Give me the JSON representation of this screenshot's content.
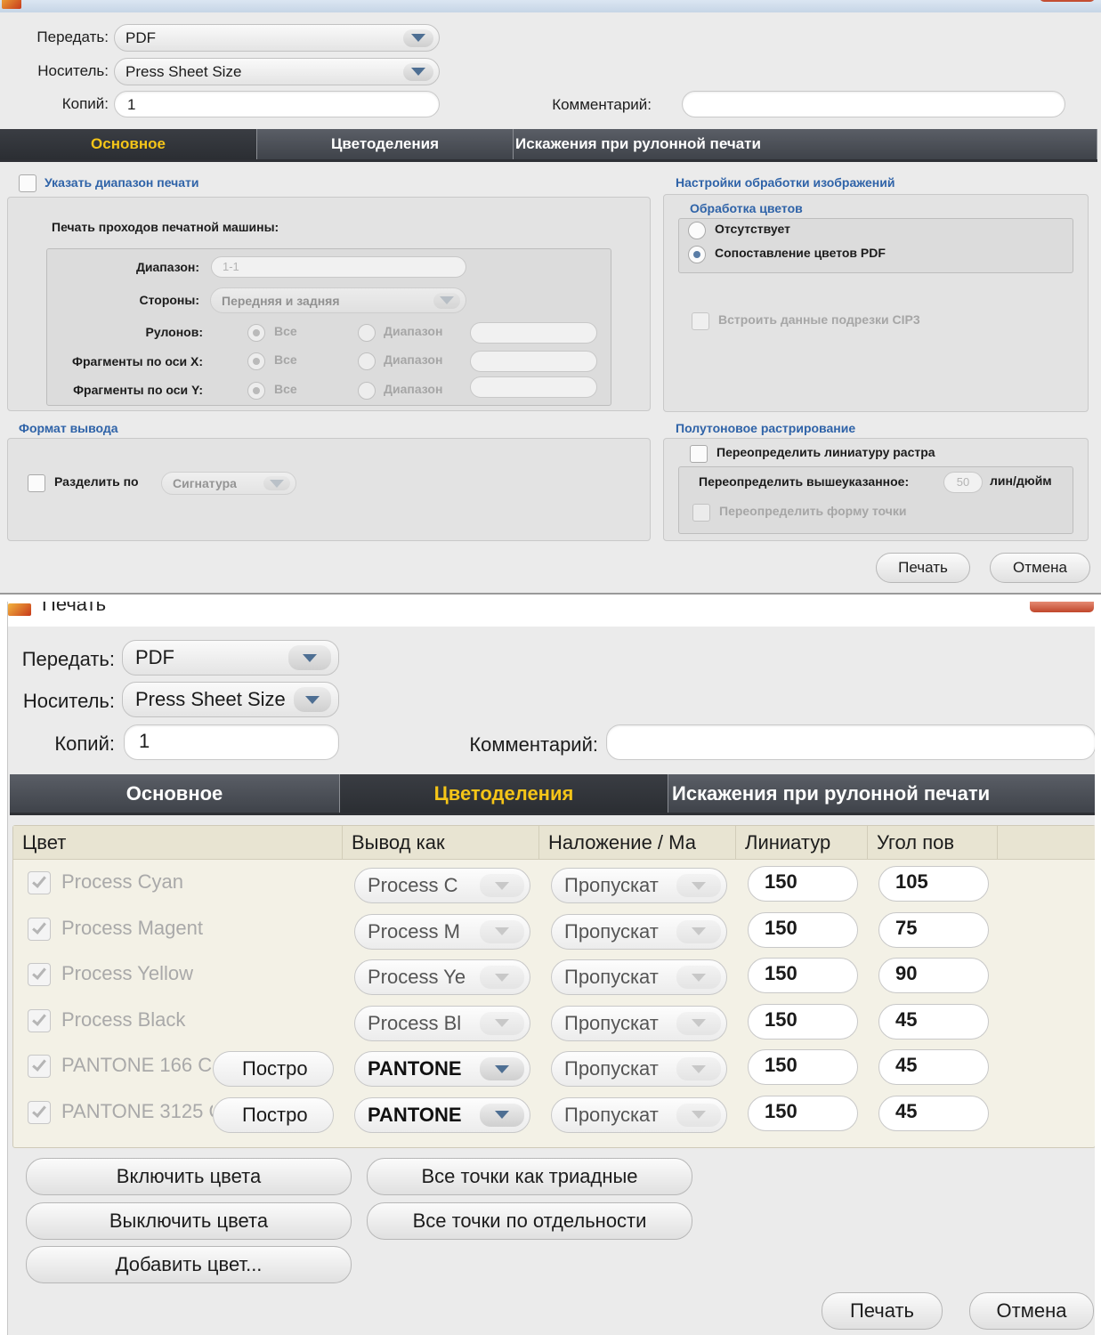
{
  "dialog1": {
    "send_label": "Передать:",
    "send_value": "PDF",
    "media_label": "Носитель:",
    "media_value": "Press Sheet Size",
    "copies_label": "Копий:",
    "copies_value": "1",
    "comment_label": "Комментарий:",
    "comment_value": "",
    "tabs": [
      "Основное",
      "Цветоделения",
      "Искажения при рулонной печати"
    ],
    "active_tab": 0,
    "print_range_label": "Указать диапазон печати",
    "print_passes_label": "Печать проходов печатной машины:",
    "range_label": "Диапазон:",
    "range_value": "1-1",
    "sides_label": "Стороны:",
    "sides_value": "Передняя и задняя",
    "rolls_label": "Рулонов:",
    "frag_x_label": "Фрагменты по оси X:",
    "frag_y_label": "Фрагменты по оси Y:",
    "all_label": "Все",
    "range_option_label": "Диапазон",
    "output_format_title": "Формат вывода",
    "split_by_label": "Разделить по",
    "split_by_value": "Сигнатура",
    "image_settings_title": "Настройки обработки изображений",
    "color_processing_title": "Обработка цветов",
    "color_opt_none": "Отсутствует",
    "color_opt_pdf": "Сопоставление цветов PDF",
    "embed_cip3_label": "Встроить данные подрезки CIP3",
    "halftone_title": "Полутоновое растрирование",
    "override_lpi_label": "Переопределить линиатуру растра",
    "override_above_label": "Переопределить вышеуказанное:",
    "lpi_value": "50",
    "lpi_unit": "лин/дюйм",
    "override_dot_label": "Переопределить форму точки",
    "print_button": "Печать",
    "cancel_button": "Отмена"
  },
  "dialog2": {
    "title": "Печать",
    "send_label": "Передать:",
    "send_value": "PDF",
    "media_label": "Носитель:",
    "media_value": "Press Sheet Size",
    "copies_label": "Копий:",
    "copies_value": "1",
    "comment_label": "Комментарий:",
    "comment_value": "",
    "tabs": [
      "Основное",
      "Цветоделения",
      "Искажения при рулонной печати"
    ],
    "active_tab": 1,
    "columns": [
      "Цвет",
      "Вывод как",
      "Наложение / Ма",
      "Линиатур",
      "Угол пов"
    ],
    "rows": [
      {
        "name": "Process Cyan",
        "build": "",
        "output": "Process C",
        "overprint": "Пропускат",
        "lpi": "150",
        "angle": "105",
        "output_enabled": false
      },
      {
        "name": "Process Magent",
        "build": "",
        "output": "Process M",
        "overprint": "Пропускат",
        "lpi": "150",
        "angle": "75",
        "output_enabled": false
      },
      {
        "name": "Process Yellow",
        "build": "",
        "output": "Process Ye",
        "overprint": "Пропускат",
        "lpi": "150",
        "angle": "90",
        "output_enabled": false
      },
      {
        "name": "Process Black",
        "build": "",
        "output": "Process Bl",
        "overprint": "Пропускат",
        "lpi": "150",
        "angle": "45",
        "output_enabled": false
      },
      {
        "name": "PANTONE 166 C",
        "build": "Постро",
        "output": "PANTONE",
        "overprint": "Пропускат",
        "lpi": "150",
        "angle": "45",
        "output_enabled": true
      },
      {
        "name": "PANTONE 3125 C",
        "build": "Постро",
        "output": "PANTONE",
        "overprint": "Пропускат",
        "lpi": "150",
        "angle": "45",
        "output_enabled": true
      }
    ],
    "enable_colors_button": "Включить цвета",
    "disable_colors_button": "Выключить цвета",
    "add_color_button": "Добавить цвет...",
    "all_process_button": "Все точки как триадные",
    "all_separate_button": "Все точки по отдельности",
    "print_button": "Печать",
    "cancel_button": "Отмена"
  },
  "colors": {
    "accent_tab": "#f5c518",
    "section_title": "#2f63a8",
    "tab_bg": "#4a4e55"
  }
}
